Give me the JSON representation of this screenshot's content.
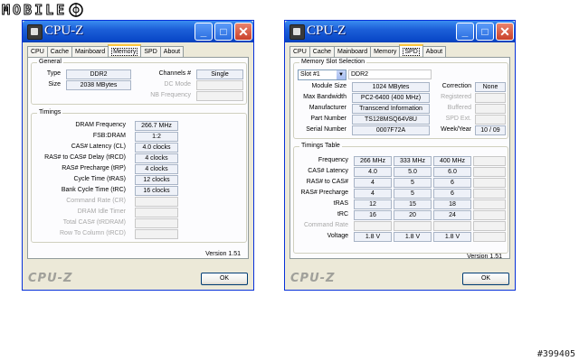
{
  "watermark": {
    "logo_text": "MOBILE",
    "code": "#399405"
  },
  "left": {
    "title": "CPU-Z",
    "tabs": [
      "CPU",
      "Cache",
      "Mainboard",
      "Memory",
      "SPD",
      "About"
    ],
    "active_tab": "Memory",
    "general": {
      "group_title": "General",
      "type_label": "Type",
      "type_value": "DDR2",
      "size_label": "Size",
      "size_value": "2038 MBytes",
      "channels_label": "Channels #",
      "channels_value": "Single",
      "dcmode_label": "DC Mode",
      "nbfreq_label": "NB Frequency"
    },
    "timings": {
      "group_title": "Timings",
      "rows": [
        {
          "label": "DRAM Frequency",
          "value": "266.7 MHz",
          "enabled": true
        },
        {
          "label": "FSB:DRAM",
          "value": "1:2",
          "enabled": true
        },
        {
          "label": "CAS# Latency (CL)",
          "value": "4.0 clocks",
          "enabled": true
        },
        {
          "label": "RAS# to CAS# Delay (tRCD)",
          "value": "4 clocks",
          "enabled": true
        },
        {
          "label": "RAS# Precharge (tRP)",
          "value": "4 clocks",
          "enabled": true
        },
        {
          "label": "Cycle Time (tRAS)",
          "value": "12 clocks",
          "enabled": true
        },
        {
          "label": "Bank Cycle Time (tRC)",
          "value": "16 clocks",
          "enabled": true
        },
        {
          "label": "Command Rate (CR)",
          "value": "",
          "enabled": false
        },
        {
          "label": "DRAM Idle Timer",
          "value": "",
          "enabled": false
        },
        {
          "label": "Total CAS# (tRDRAM)",
          "value": "",
          "enabled": false
        },
        {
          "label": "Row To Column (tRCD)",
          "value": "",
          "enabled": false
        }
      ]
    },
    "version": "Version 1.51",
    "footer_logo": "CPU-Z",
    "ok_label": "OK"
  },
  "right": {
    "title": "CPU-Z",
    "tabs": [
      "CPU",
      "Cache",
      "Mainboard",
      "Memory",
      "SPD",
      "About"
    ],
    "active_tab": "SPD",
    "slot": {
      "group_title": "Memory Slot Selection",
      "selected": "Slot #1",
      "type_value": "DDR2",
      "module_size_label": "Module Size",
      "module_size_value": "1024 MBytes",
      "max_bandwidth_label": "Max Bandwidth",
      "max_bandwidth_value": "PC2-6400 (400 MHz)",
      "manufacturer_label": "Manufacturer",
      "manufacturer_value": "Transcend Information",
      "part_number_label": "Part Number",
      "part_number_value": "TS128MSQ64V8U",
      "serial_number_label": "Serial Number",
      "serial_number_value": "0007F72A",
      "correction_label": "Correction",
      "correction_value": "None",
      "registered_label": "Registered",
      "buffered_label": "Buffered",
      "spd_ext_label": "SPD Ext.",
      "week_year_label": "Week/Year",
      "week_year_value": "10 / 09"
    },
    "timings_table": {
      "group_title": "Timings Table",
      "rows": [
        {
          "label": "Frequency",
          "values": [
            "266 MHz",
            "333 MHz",
            "400 MHz"
          ],
          "enabled": true
        },
        {
          "label": "CAS# Latency",
          "values": [
            "4.0",
            "5.0",
            "6.0"
          ],
          "enabled": true
        },
        {
          "label": "RAS# to CAS#",
          "values": [
            "4",
            "5",
            "6"
          ],
          "enabled": true
        },
        {
          "label": "RAS# Precharge",
          "values": [
            "4",
            "5",
            "6"
          ],
          "enabled": true
        },
        {
          "label": "tRAS",
          "values": [
            "12",
            "15",
            "18"
          ],
          "enabled": true
        },
        {
          "label": "tRC",
          "values": [
            "16",
            "20",
            "24"
          ],
          "enabled": true
        },
        {
          "label": "Command Rate",
          "values": [
            "",
            "",
            ""
          ],
          "enabled": false
        },
        {
          "label": "Voltage",
          "values": [
            "1.8 V",
            "1.8 V",
            "1.8 V"
          ],
          "enabled": true
        }
      ]
    },
    "version": "Version 1.51",
    "footer_logo": "CPU-Z",
    "ok_label": "OK"
  }
}
